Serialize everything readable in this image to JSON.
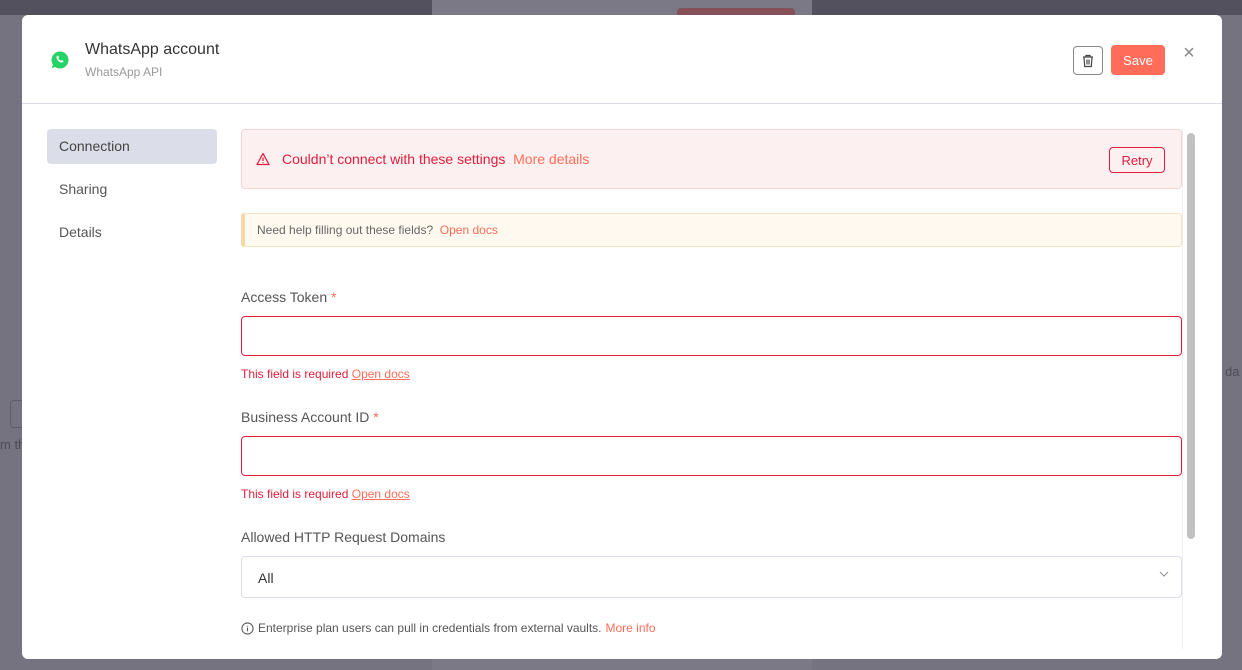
{
  "background": {
    "left_fragment": "m th",
    "right_fragment": "da"
  },
  "header": {
    "title": "WhatsApp account",
    "subtitle": "WhatsApp API",
    "save_label": "Save",
    "brand_color": "#25d366"
  },
  "sidebar": {
    "items": [
      {
        "label": "Connection",
        "active": true
      },
      {
        "label": "Sharing"
      },
      {
        "label": "Details"
      }
    ]
  },
  "error_banner": {
    "message": "Couldn’t connect with these settings",
    "link": "More details",
    "retry_label": "Retry"
  },
  "help_banner": {
    "text": "Need help filling out these fields?",
    "link": "Open docs"
  },
  "fields": [
    {
      "label": "Access Token",
      "required": "*",
      "value": "",
      "error": "This field is required",
      "error_link": "Open docs"
    },
    {
      "label": "Business Account ID",
      "required": "*",
      "value": "",
      "error": "This field is required",
      "error_link": "Open docs"
    }
  ],
  "domains": {
    "label": "Allowed HTTP Request Domains",
    "value": "All"
  },
  "note": {
    "text": "Enterprise plan users can pull in credentials from external vaults.",
    "link": "More info"
  },
  "colors": {
    "accent": "#ff6d5a",
    "error": "#e21d3c"
  }
}
